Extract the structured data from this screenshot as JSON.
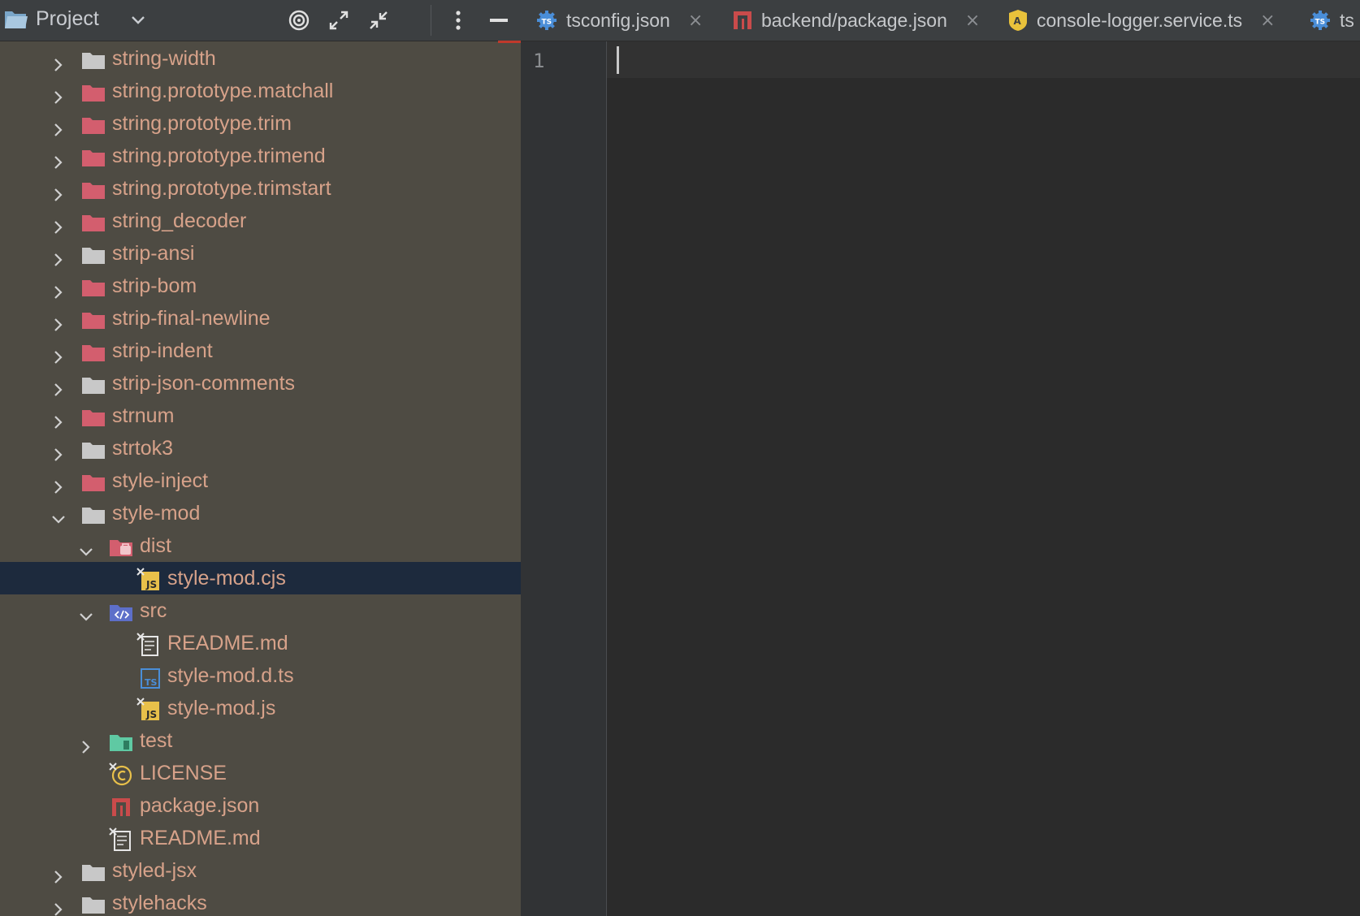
{
  "panel": {
    "title": "Project",
    "buttons": [
      "target-icon",
      "expand-icon",
      "collapse-icon",
      "more-icon",
      "minimize-icon"
    ]
  },
  "tree": [
    {
      "label": "string-width",
      "depth": 0,
      "expanded": false,
      "icon": "folder-gray"
    },
    {
      "label": "string.prototype.matchall",
      "depth": 0,
      "expanded": false,
      "icon": "folder-red"
    },
    {
      "label": "string.prototype.trim",
      "depth": 0,
      "expanded": false,
      "icon": "folder-red"
    },
    {
      "label": "string.prototype.trimend",
      "depth": 0,
      "expanded": false,
      "icon": "folder-red"
    },
    {
      "label": "string.prototype.trimstart",
      "depth": 0,
      "expanded": false,
      "icon": "folder-red"
    },
    {
      "label": "string_decoder",
      "depth": 0,
      "expanded": false,
      "icon": "folder-red"
    },
    {
      "label": "strip-ansi",
      "depth": 0,
      "expanded": false,
      "icon": "folder-gray"
    },
    {
      "label": "strip-bom",
      "depth": 0,
      "expanded": false,
      "icon": "folder-red"
    },
    {
      "label": "strip-final-newline",
      "depth": 0,
      "expanded": false,
      "icon": "folder-red"
    },
    {
      "label": "strip-indent",
      "depth": 0,
      "expanded": false,
      "icon": "folder-red"
    },
    {
      "label": "strip-json-comments",
      "depth": 0,
      "expanded": false,
      "icon": "folder-gray"
    },
    {
      "label": "strnum",
      "depth": 0,
      "expanded": false,
      "icon": "folder-red"
    },
    {
      "label": "strtok3",
      "depth": 0,
      "expanded": false,
      "icon": "folder-gray"
    },
    {
      "label": "style-inject",
      "depth": 0,
      "expanded": false,
      "icon": "folder-red"
    },
    {
      "label": "style-mod",
      "depth": 0,
      "expanded": true,
      "icon": "folder-gray"
    },
    {
      "label": "dist",
      "depth": 1,
      "expanded": true,
      "icon": "folder-dist"
    },
    {
      "label": "style-mod.cjs",
      "depth": 2,
      "icon": "js-file",
      "selected": true
    },
    {
      "label": "src",
      "depth": 1,
      "expanded": true,
      "icon": "folder-src"
    },
    {
      "label": "README.md",
      "depth": 2,
      "icon": "md-file"
    },
    {
      "label": "style-mod.d.ts",
      "depth": 2,
      "icon": "ts-file"
    },
    {
      "label": "style-mod.js",
      "depth": 2,
      "icon": "js-file"
    },
    {
      "label": "test",
      "depth": 1,
      "expanded": false,
      "icon": "folder-test"
    },
    {
      "label": "LICENSE",
      "depth": 1,
      "icon": "license-file"
    },
    {
      "label": "package.json",
      "depth": 1,
      "icon": "npm-file"
    },
    {
      "label": "README.md",
      "depth": 1,
      "icon": "md-file"
    },
    {
      "label": "styled-jsx",
      "depth": 0,
      "expanded": false,
      "icon": "folder-gray"
    },
    {
      "label": "stylehacks",
      "depth": 0,
      "expanded": false,
      "icon": "folder-gray"
    }
  ],
  "tabs": [
    {
      "label": "tsconfig.json",
      "icon": "tsconfig-icon",
      "close": "×"
    },
    {
      "label": "backend/package.json",
      "icon": "npm-icon",
      "close": "×"
    },
    {
      "label": "console-logger.service.ts",
      "icon": "angular-icon",
      "close": "×"
    },
    {
      "label": "ts",
      "icon": "tsconfig-icon",
      "close": ""
    }
  ],
  "editor": {
    "line_numbers": [
      "1"
    ]
  },
  "colors": {
    "panel_bg": "#4e4b43",
    "selection": "#1d2a3d",
    "file_text": "#d7a28a",
    "folder_red": "#d35e6e",
    "folder_gray": "#c8c8c8"
  }
}
